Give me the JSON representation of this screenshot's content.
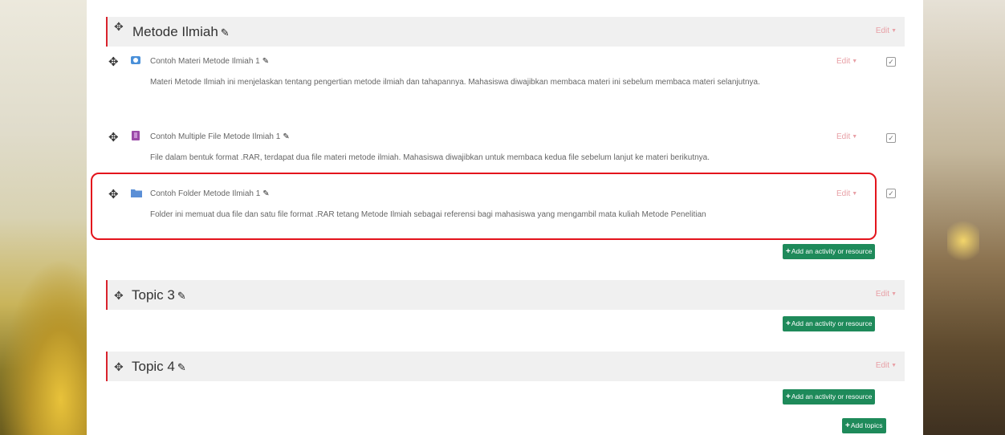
{
  "sections": [
    {
      "title": "Metode Ilmiah",
      "edit": "Edit"
    },
    {
      "title": "Topic 3",
      "edit": "Edit"
    },
    {
      "title": "Topic 4",
      "edit": "Edit"
    }
  ],
  "activities": [
    {
      "name": "Contoh Materi Metode Ilmiah 1",
      "icon": "url-icon",
      "edit": "Edit",
      "description": "Materi Metode Ilmiah ini menjelaskan tentang pengertian metode ilmiah dan tahapannya. Mahasiswa diwajibkan membaca materi ini sebelum membaca materi selanjutnya."
    },
    {
      "name": "Contoh Multiple File Metode Ilmiah 1",
      "icon": "file-icon",
      "edit": "Edit",
      "description": "File dalam bentuk format .RAR, terdapat dua file materi metode ilmiah. Mahasiswa diwajibkan untuk membaca kedua file sebelum lanjut ke materi berikutnya."
    },
    {
      "name": "Contoh Folder Metode Ilmiah 1",
      "icon": "folder-icon",
      "edit": "Edit",
      "description": "Folder ini memuat dua file dan satu file format .RAR tetang Metode Ilmiah sebagai referensi bagi mahasiswa yang mengambil mata kuliah Metode Penelitian"
    }
  ],
  "buttons": {
    "add_activity": "Add an activity or resource",
    "add_topics": "Add topics"
  },
  "colors": {
    "accent_red": "#d9232d",
    "button_green": "#1e8a5a",
    "highlight": "#e3141c"
  }
}
